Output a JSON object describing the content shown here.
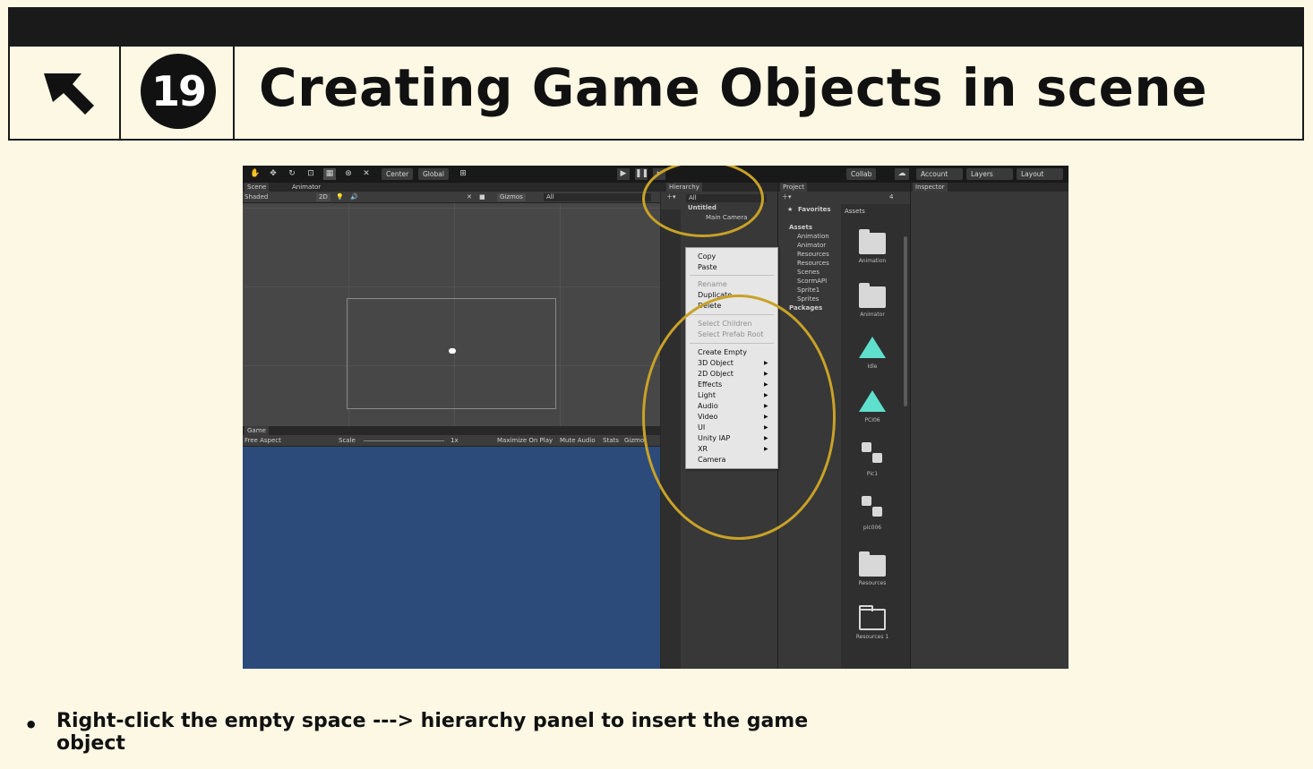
{
  "slide": {
    "number": "19",
    "title": "Creating Game Objects in scene",
    "bullet": "Right-click the empty space ---> hierarchy panel to insert the game object"
  },
  "colors": {
    "highlight": "#c9a227",
    "game_bg": "#2c4b7a",
    "icon_teal": "#5fe0cf"
  },
  "toolbar": {
    "center": "Center",
    "global": "Global",
    "collab": "Collab",
    "account": "Account",
    "layers": "Layers",
    "layout": "Layout"
  },
  "scene_panel": {
    "tab_scene": "Scene",
    "tab_animator": "Animator",
    "shading": "Shaded",
    "mode_2d": "2D",
    "gizmos": "Gizmos",
    "search": "All"
  },
  "game_panel": {
    "tab": "Game",
    "aspect": "Free Aspect",
    "scale_label": "Scale",
    "scale_value": "1x",
    "maximize": "Maximize On Play",
    "mute": "Mute Audio",
    "stats": "Stats",
    "gizmos": "Gizmo"
  },
  "hierarchy": {
    "tab": "Hierarchy",
    "search": "All",
    "scene": "Untitled",
    "items": [
      "Main Camera"
    ]
  },
  "context_menu": {
    "copy": "Copy",
    "paste": "Paste",
    "rename": "Rename",
    "duplicate": "Duplicate",
    "delete": "Delete",
    "select_children": "Select Children",
    "select_prefab_root": "Select Prefab Root",
    "create_empty": "Create Empty",
    "submenus": [
      "3D Object",
      "2D Object",
      "Effects",
      "Light",
      "Audio",
      "Video",
      "UI",
      "Unity IAP",
      "XR"
    ],
    "camera": "Camera"
  },
  "project": {
    "tab": "Project",
    "favorites": "Favorites",
    "assets_header": "Assets",
    "tree": [
      "Assets",
      "Animation",
      "Animator",
      "Resources",
      "Resources",
      "Scenes",
      "ScormAPI",
      "Sprite1",
      "Sprites",
      "Packages"
    ],
    "asset_badge": "4",
    "asset_items": [
      "Animation",
      "Animator",
      "Idle",
      "PCI06",
      "Pic1",
      "pic006",
      "Resources",
      "Resources 1"
    ]
  },
  "inspector": {
    "tab": "Inspector"
  }
}
